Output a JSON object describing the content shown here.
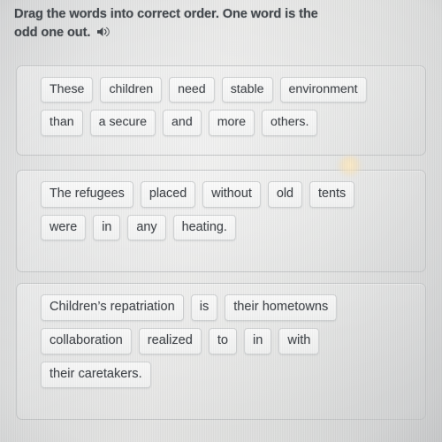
{
  "header": {
    "prompt_line_1": "Drag the words into correct order. One word is the",
    "prompt_line_2": "odd one out.",
    "speaker_icon": "speaker-audio-icon"
  },
  "colors": {
    "background": "#dcdddd",
    "card_border": "#c4c6c7",
    "chip_border": "#cfd1d2",
    "chip_fill": "#f7f8f8",
    "text": "#3f4348",
    "header_text": "#41464b",
    "glare": "#f8e2b6"
  },
  "exercises": [
    {
      "id": "exercise-1",
      "rows": [
        [
          "These",
          "children",
          "need",
          "stable",
          "environment"
        ],
        [
          "than",
          "a secure",
          "and",
          "more",
          "others."
        ]
      ]
    },
    {
      "id": "exercise-2",
      "rows": [
        [
          "The refugees",
          "placed",
          "without",
          "old",
          "tents"
        ],
        [
          "were",
          "in",
          "any",
          "heating."
        ]
      ]
    },
    {
      "id": "exercise-3",
      "rows": [
        [
          "Children’s repatriation",
          "is",
          "their hometowns"
        ],
        [
          "collaboration",
          "realized",
          "to",
          "in",
          "with"
        ],
        [
          "their caretakers."
        ]
      ]
    }
  ]
}
